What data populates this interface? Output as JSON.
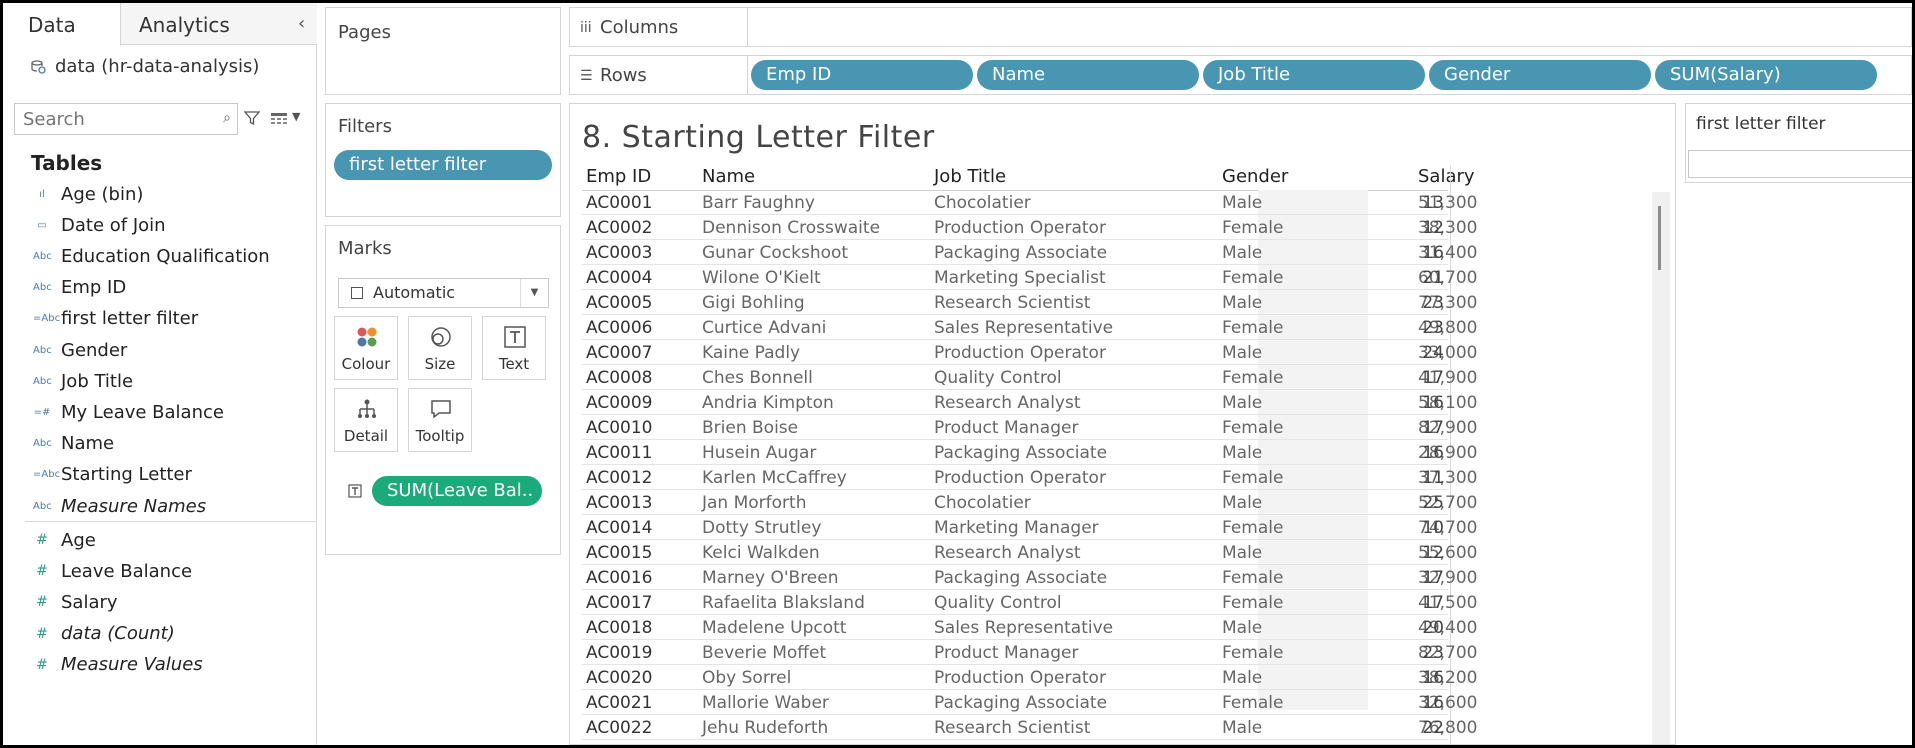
{
  "data_pane": {
    "tabs": [
      "Data",
      "Analytics"
    ],
    "datasource": "data (hr-data-analysis)",
    "search_placeholder": "Search",
    "tables_heading": "Tables",
    "dimensions": [
      {
        "icon": "bin-icon",
        "label": "Age (bin)"
      },
      {
        "icon": "calendar-icon",
        "label": "Date of Join"
      },
      {
        "icon": "abc-icon",
        "label": "Education Qualification"
      },
      {
        "icon": "abc-icon",
        "label": "Emp ID"
      },
      {
        "icon": "calc-abc-icon",
        "label": "first letter filter"
      },
      {
        "icon": "abc-icon",
        "label": "Gender"
      },
      {
        "icon": "abc-icon",
        "label": "Job Title"
      },
      {
        "icon": "calc-number-icon",
        "label": "My Leave Balance"
      },
      {
        "icon": "abc-icon",
        "label": "Name"
      },
      {
        "icon": "calc-abc-icon",
        "label": "Starting Letter"
      },
      {
        "icon": "abc-icon",
        "label": "Measure Names"
      }
    ],
    "measures": [
      {
        "icon": "number-icon",
        "label": "Age"
      },
      {
        "icon": "number-icon",
        "label": "Leave Balance"
      },
      {
        "icon": "number-icon",
        "label": "Salary"
      },
      {
        "icon": "number-icon",
        "label": "data (Count)"
      },
      {
        "icon": "number-icon",
        "label": "Measure Values"
      }
    ]
  },
  "pages": {
    "title": "Pages"
  },
  "filters": {
    "title": "Filters",
    "pill": "first letter filter"
  },
  "marks": {
    "title": "Marks",
    "type": "Automatic",
    "buttons": [
      "Colour",
      "Size",
      "Text",
      "Detail",
      "Tooltip"
    ],
    "pill": "SUM(Leave Bal.."
  },
  "columns_shelf": {
    "label": "Columns"
  },
  "rows_shelf": {
    "label": "Rows",
    "pills": [
      "Emp ID",
      "Name",
      "Job Title",
      "Gender",
      "SUM(Salary)"
    ]
  },
  "view": {
    "title": "8. Starting Letter Filter",
    "headers": [
      "Emp ID",
      "Name",
      "Job Title",
      "Gender",
      "Salary"
    ],
    "rows": [
      [
        "AC0001",
        "Barr Faughny",
        "Chocolatier",
        "Male",
        "51,300",
        "13"
      ],
      [
        "AC0002",
        "Dennison Crosswaite",
        "Production Operator",
        "Female",
        "38,300",
        "12"
      ],
      [
        "AC0003",
        "Gunar Cockshoot",
        "Packaging Associate",
        "Male",
        "31,400",
        "16"
      ],
      [
        "AC0004",
        "Wilone O'Kielt",
        "Marketing Specialist",
        "Female",
        "60,700",
        "21"
      ],
      [
        "AC0005",
        "Gigi Bohling",
        "Research Scientist",
        "Male",
        "77,300",
        "23"
      ],
      [
        "AC0006",
        "Curtice Advani",
        "Sales Representative",
        "Female",
        "49,800",
        "23"
      ],
      [
        "AC0007",
        "Kaine Padly",
        "Production Operator",
        "Male",
        "33,000",
        "24"
      ],
      [
        "AC0008",
        "Ches Bonnell",
        "Quality Control",
        "Female",
        "41,900",
        "17"
      ],
      [
        "AC0009",
        "Andria Kimpton",
        "Research Analyst",
        "Male",
        "58,100",
        "16"
      ],
      [
        "AC0010",
        "Brien Boise",
        "Product Manager",
        "Female",
        "82,900",
        "17"
      ],
      [
        "AC0011",
        "Husein Augar",
        "Packaging Associate",
        "Male",
        "28,900",
        "16"
      ],
      [
        "AC0012",
        "Karlen McCaffrey",
        "Production Operator",
        "Female",
        "37,300",
        "11"
      ],
      [
        "AC0013",
        "Jan Morforth",
        "Chocolatier",
        "Male",
        "52,700",
        "25"
      ],
      [
        "AC0014",
        "Dotty Strutley",
        "Marketing Manager",
        "Female",
        "74,700",
        "10"
      ],
      [
        "AC0015",
        "Kelci Walkden",
        "Research Analyst",
        "Male",
        "55,600",
        "12"
      ],
      [
        "AC0016",
        "Marney O'Breen",
        "Packaging Associate",
        "Female",
        "32,900",
        "17"
      ],
      [
        "AC0017",
        "Rafaelita Blaksland",
        "Quality Control",
        "Female",
        "41,500",
        "17"
      ],
      [
        "AC0018",
        "Madelene Upcott",
        "Sales Representative",
        "Male",
        "49,400",
        "20"
      ],
      [
        "AC0019",
        "Beverie Moffet",
        "Product Manager",
        "Female",
        "82,700",
        "23"
      ],
      [
        "AC0020",
        "Oby Sorrel",
        "Production Operator",
        "Male",
        "38,200",
        "16"
      ],
      [
        "AC0021",
        "Mallorie Waber",
        "Packaging Associate",
        "Female",
        "32,600",
        "16"
      ],
      [
        "AC0022",
        "Jehu Rudeforth",
        "Research Scientist",
        "Male",
        "76,800",
        "22"
      ]
    ]
  },
  "filter_card": {
    "title": "first letter filter",
    "value": ""
  },
  "colors": {
    "pill_blue": "#4996b2",
    "pill_green": "#1bab7a",
    "dimension_icon": "#4e79a7",
    "measure_icon": "#2e9e85"
  }
}
